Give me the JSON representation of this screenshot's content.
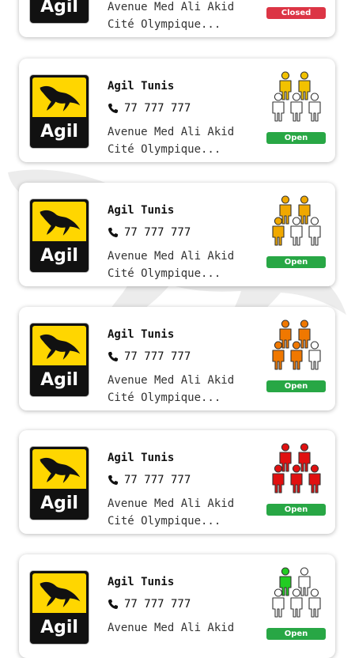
{
  "stations": [
    {
      "logo_text": "Agil",
      "name": "",
      "phone": "",
      "address": "Avenue Med Ali Akid Cité Olympique...",
      "status": "Closed",
      "crowd_colors": [
        "#ffffff",
        "#ffffff",
        "#ffffff",
        "#ffffff",
        "#ffffff"
      ]
    },
    {
      "logo_text": "Agil",
      "name": "Agil Tunis",
      "phone": "77 777 777",
      "address": "Avenue Med Ali Akid Cité Olympique...",
      "status": "Open",
      "crowd_colors": [
        "#f2c200",
        "#f2c200",
        "#ffffff",
        "#ffffff",
        "#ffffff"
      ]
    },
    {
      "logo_text": "Agil",
      "name": "Agil Tunis",
      "phone": "77 777 777",
      "address": "Avenue Med Ali Akid Cité Olympique...",
      "status": "Open",
      "crowd_colors": [
        "#f0a800",
        "#f0a800",
        "#f0a800",
        "#ffffff",
        "#ffffff"
      ]
    },
    {
      "logo_text": "Agil",
      "name": "Agil Tunis",
      "phone": "77 777 777",
      "address": "Avenue Med Ali Akid Cité Olympique...",
      "status": "Open",
      "crowd_colors": [
        "#f07800",
        "#f07800",
        "#f07800",
        "#f07800",
        "#ffffff"
      ]
    },
    {
      "logo_text": "Agil",
      "name": "Agil Tunis",
      "phone": "77 777 777",
      "address": "Avenue Med Ali Akid Cité Olympique...",
      "status": "Open",
      "crowd_colors": [
        "#e01010",
        "#e01010",
        "#e01010",
        "#e01010",
        "#e01010"
      ]
    },
    {
      "logo_text": "Agil",
      "name": "Agil Tunis",
      "phone": "77 777 777",
      "address": "Avenue Med Ali Akid",
      "status": "Open",
      "crowd_colors": [
        "#22cc22",
        "#ffffff",
        "#ffffff",
        "#ffffff",
        "#ffffff"
      ]
    }
  ],
  "colors": {
    "open": "#28a745",
    "closed": "#dc3545",
    "logo_yellow": "#ffd600"
  },
  "icons": {
    "phone": "phone-icon",
    "crowd": "crowd-level-icon",
    "logo": "agil-horse-logo"
  }
}
